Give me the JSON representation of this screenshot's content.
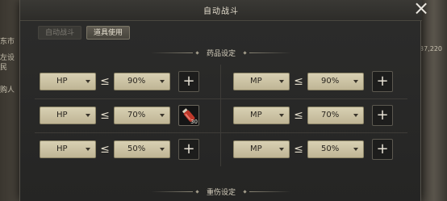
{
  "background": {
    "left_texts": [
      "东市",
      "左设",
      "民",
      "购人"
    ],
    "right_text": "37,220"
  },
  "dialog": {
    "title": "自动战斗",
    "close_label": "×",
    "tabs": [
      {
        "label": "自动战斗",
        "active": false
      },
      {
        "label": "道具使用",
        "active": true
      }
    ],
    "potion_section": {
      "title": "药品设定",
      "operator": "≤",
      "rows": [
        {
          "left": {
            "stat": "HP",
            "threshold": "90%",
            "slot": {
              "type": "add",
              "label": "+"
            }
          },
          "right": {
            "stat": "MP",
            "threshold": "90%",
            "slot": {
              "type": "add",
              "label": "+"
            }
          }
        },
        {
          "left": {
            "stat": "HP",
            "threshold": "70%",
            "slot": {
              "type": "item",
              "icon": "red-potion-icon",
              "count": "30"
            }
          },
          "right": {
            "stat": "MP",
            "threshold": "70%",
            "slot": {
              "type": "add",
              "label": "+"
            }
          }
        },
        {
          "left": {
            "stat": "HP",
            "threshold": "50%",
            "slot": {
              "type": "add",
              "label": "+"
            }
          },
          "right": {
            "stat": "MP",
            "threshold": "50%",
            "slot": {
              "type": "add",
              "label": "+"
            }
          }
        }
      ]
    },
    "injury_section": {
      "title": "重伤设定"
    },
    "colors": {
      "dropdown_bg": "#d8d0b3",
      "panel_bg": "#2c2c2b",
      "text_light": "#e6dfcf",
      "potion_red": "#c0392b"
    }
  }
}
